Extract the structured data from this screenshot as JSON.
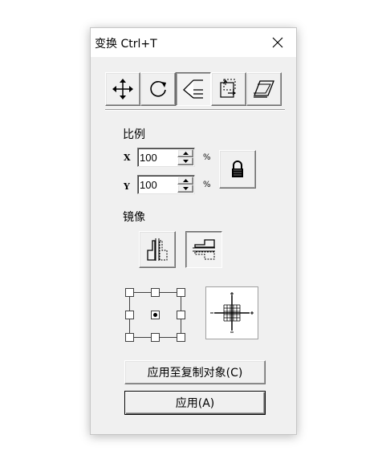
{
  "window": {
    "title": "变换 Ctrl+T"
  },
  "tabs": [
    {
      "id": "position",
      "icon": "move-arrows-icon",
      "selected": false
    },
    {
      "id": "rotate",
      "icon": "rotate-icon",
      "selected": false
    },
    {
      "id": "scale-mirror",
      "icon": "scale-mirror-icon",
      "selected": true
    },
    {
      "id": "size",
      "icon": "size-icon",
      "selected": false
    },
    {
      "id": "skew",
      "icon": "skew-icon",
      "selected": false
    }
  ],
  "scale": {
    "heading": "比例",
    "x_label": "X",
    "x_value": "100",
    "y_label": "Y",
    "y_value": "100",
    "unit": "%",
    "lock_icon": "lock-icon"
  },
  "mirror": {
    "heading": "镜像",
    "horizontal_icon": "mirror-horizontal-icon",
    "vertical_icon": "mirror-vertical-icon",
    "vertical_selected": true
  },
  "anchor": {
    "selected": "center"
  },
  "buttons": {
    "apply_copy": "应用至复制对象(C)",
    "apply": "应用(A)"
  }
}
